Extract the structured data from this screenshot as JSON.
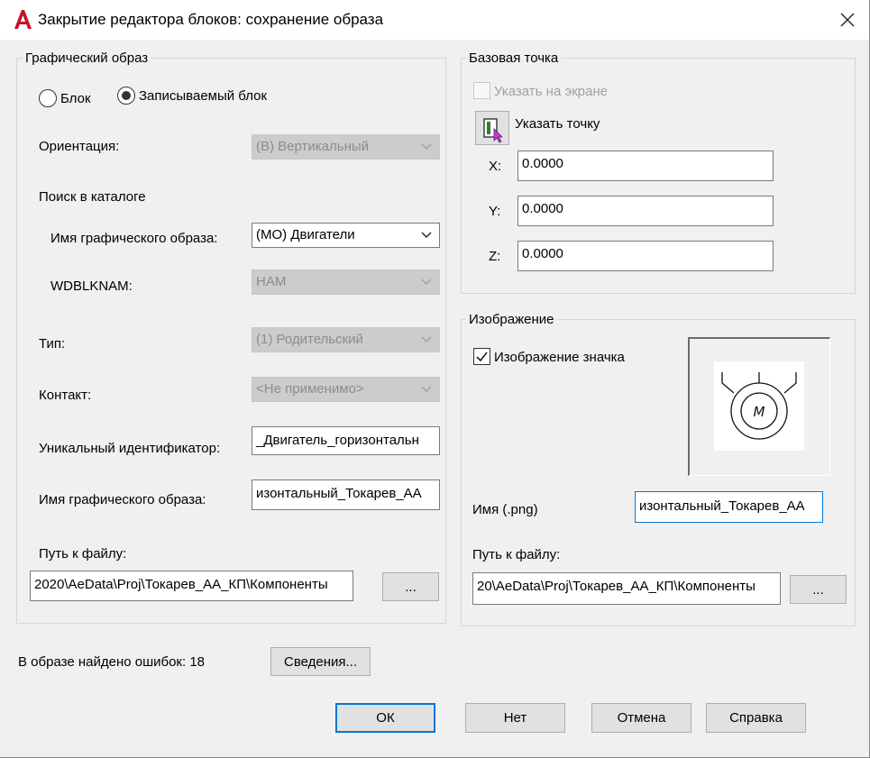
{
  "window": {
    "title": "Закрытие редактора блоков: сохранение образа",
    "app_icon": "autocad-a-icon",
    "close_icon": "close-icon"
  },
  "graphic": {
    "legend": "Графический образ",
    "radio_block": "Блок",
    "radio_wblock": "Записываемый блок",
    "selected_radio": "Записываемый блок",
    "orientation_label": "Ориентация:",
    "orientation_value": "(В) Вертикальный",
    "catalog_search": "Поиск в каталоге",
    "symbol_name_label": "Имя графического образа:",
    "symbol_name_value": "(МО) Двигатели",
    "wdblknam_label": "WDBLKNAM:",
    "wdblknam_value": "НАМ",
    "type_label": "Тип:",
    "type_value": "(1) Родительский",
    "contact_label": "Контакт:",
    "contact_value": "<Не применимо>",
    "unique_id_label": "Уникальный идентификатор:",
    "unique_id_value": "_Двигатель_горизонтальн",
    "image_name_label": "Имя графического образа:",
    "image_name_value": "изонтальный_Токарев_АА",
    "path_label": "Путь к файлу:",
    "path_value": "2020\\AeData\\Proj\\Токарев_АА_КП\\Компоненты",
    "browse_label": "..."
  },
  "basepoint": {
    "legend": "Базовая точка",
    "specify_on_screen": "Указать на экране",
    "pick_point": "Указать точку",
    "x_label": "X:",
    "x_value": "0.0000",
    "y_label": "Y:",
    "y_value": "0.0000",
    "z_label": "Z:",
    "z_value": "0.0000"
  },
  "image": {
    "legend": "Изображение",
    "icon_image_label": "Изображение значка",
    "icon_image_checked": true,
    "motor_letter": "М",
    "png_name_label": "Имя (.png)",
    "png_name_value": "изонтальный_Токарев_АА",
    "path_label": "Путь к файлу:",
    "path_value": "20\\AeData\\Proj\\Токарев_АА_КП\\Компоненты",
    "browse_label": "..."
  },
  "footer": {
    "errors_text": "В образе найдено ошибок: 18",
    "details_button": "Сведения...",
    "ok_button": "ОК",
    "no_button": "Нет",
    "cancel_button": "Отмена",
    "help_button": "Справка"
  }
}
